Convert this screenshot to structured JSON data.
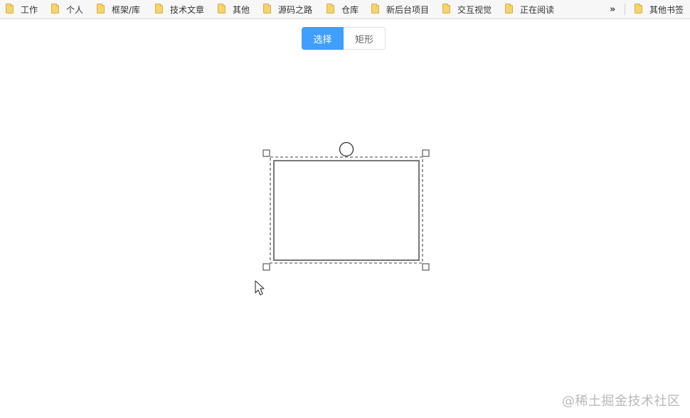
{
  "bookmarks": {
    "items": [
      {
        "label": "工作"
      },
      {
        "label": "个人"
      },
      {
        "label": "框架/库"
      },
      {
        "label": "技术文章"
      },
      {
        "label": "其他"
      },
      {
        "label": "源码之路"
      },
      {
        "label": "仓库"
      },
      {
        "label": "新后台项目"
      },
      {
        "label": "交互视觉"
      },
      {
        "label": "正在阅读"
      }
    ],
    "more": "»",
    "other": "其他书签"
  },
  "toolbar": {
    "select_label": "选择",
    "rect_label": "矩形",
    "active_tool": "选择"
  },
  "colors": {
    "accent": "#409eff",
    "shape_stroke": "#777777",
    "folder": "#f6d36b"
  },
  "watermark": "@稀土掘金技术社区"
}
